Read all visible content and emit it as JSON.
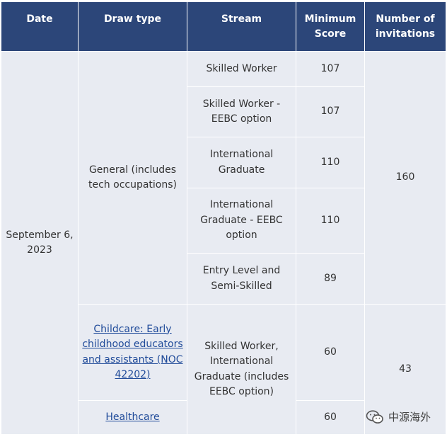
{
  "headers": {
    "date": "Date",
    "draw_type": "Draw type",
    "stream": "Stream",
    "min_score": "Minimum Score",
    "invitations": "Number of invitations"
  },
  "date": "September 6, 2023",
  "general": {
    "draw_type": "General (includes tech occupations)",
    "invitations": "160",
    "rows": [
      {
        "stream": "Skilled Worker",
        "score": "107"
      },
      {
        "stream": "Skilled Worker - EEBC option",
        "score": "107"
      },
      {
        "stream": "International Graduate",
        "score": "110"
      },
      {
        "stream": "International Graduate - EEBC option",
        "score": "110"
      },
      {
        "stream": "Entry Level and Semi-Skilled",
        "score": "89"
      }
    ]
  },
  "targeted": {
    "stream": "Skilled Worker, International Graduate (includes EEBC option)",
    "invitations": "43",
    "rows": [
      {
        "draw_type": "Childcare: Early childhood educators and assistants (NOC 42202)",
        "score": "60"
      },
      {
        "draw_type": "Healthcare",
        "score": "60"
      }
    ]
  },
  "watermark": "中源海外"
}
